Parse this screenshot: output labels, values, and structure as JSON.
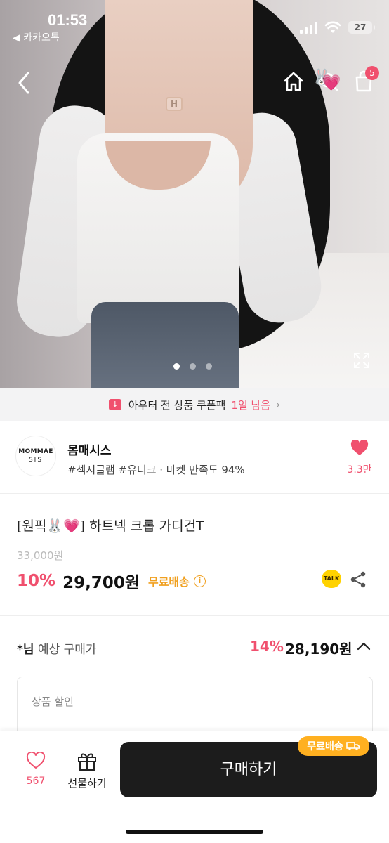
{
  "status_bar": {
    "time": "01:53",
    "back_app": "◀ 카카오톡",
    "battery": "27",
    "icons": [
      "signal-icon",
      "wifi-icon",
      "battery-icon"
    ]
  },
  "nav": {
    "icons": [
      "back-icon",
      "home-icon",
      "search-icon",
      "cart-icon"
    ],
    "cart_count": "5"
  },
  "hero": {
    "pendant_letter": "H",
    "image_count": 3,
    "active_index": 0
  },
  "coupon_banner": {
    "text": "아우터 전 상품 쿠폰팩",
    "remaining": "1일 남음",
    "chevron": "›"
  },
  "shop": {
    "logo_line1": "MOMMAE",
    "logo_line2": "SIS",
    "name": "몸매시스",
    "tags": "#섹시글램 #유니크 · 마켓 만족도 94%",
    "likes": "3.3만"
  },
  "product": {
    "title": "[원픽🐰💗] 하트넥 크롭 가디건T",
    "original_price": "33,000원",
    "discount_rate": "10%",
    "price": "29,700원",
    "shipping": "무료배송",
    "talk_label": "TALK"
  },
  "member_price": {
    "user": "*님",
    "label": "예상 구매가",
    "discount_rate": "14%",
    "price": "28,190원"
  },
  "discount_box": {
    "label": "상품 할인"
  },
  "bottom_bar": {
    "likes": "567",
    "gift_label": "선물하기",
    "buy_label": "구매하기",
    "free_shipping": "무료배송"
  },
  "colors": {
    "accent": "#f0506e",
    "shipping": "#f0a020",
    "buy_button": "#1c1c1c"
  }
}
